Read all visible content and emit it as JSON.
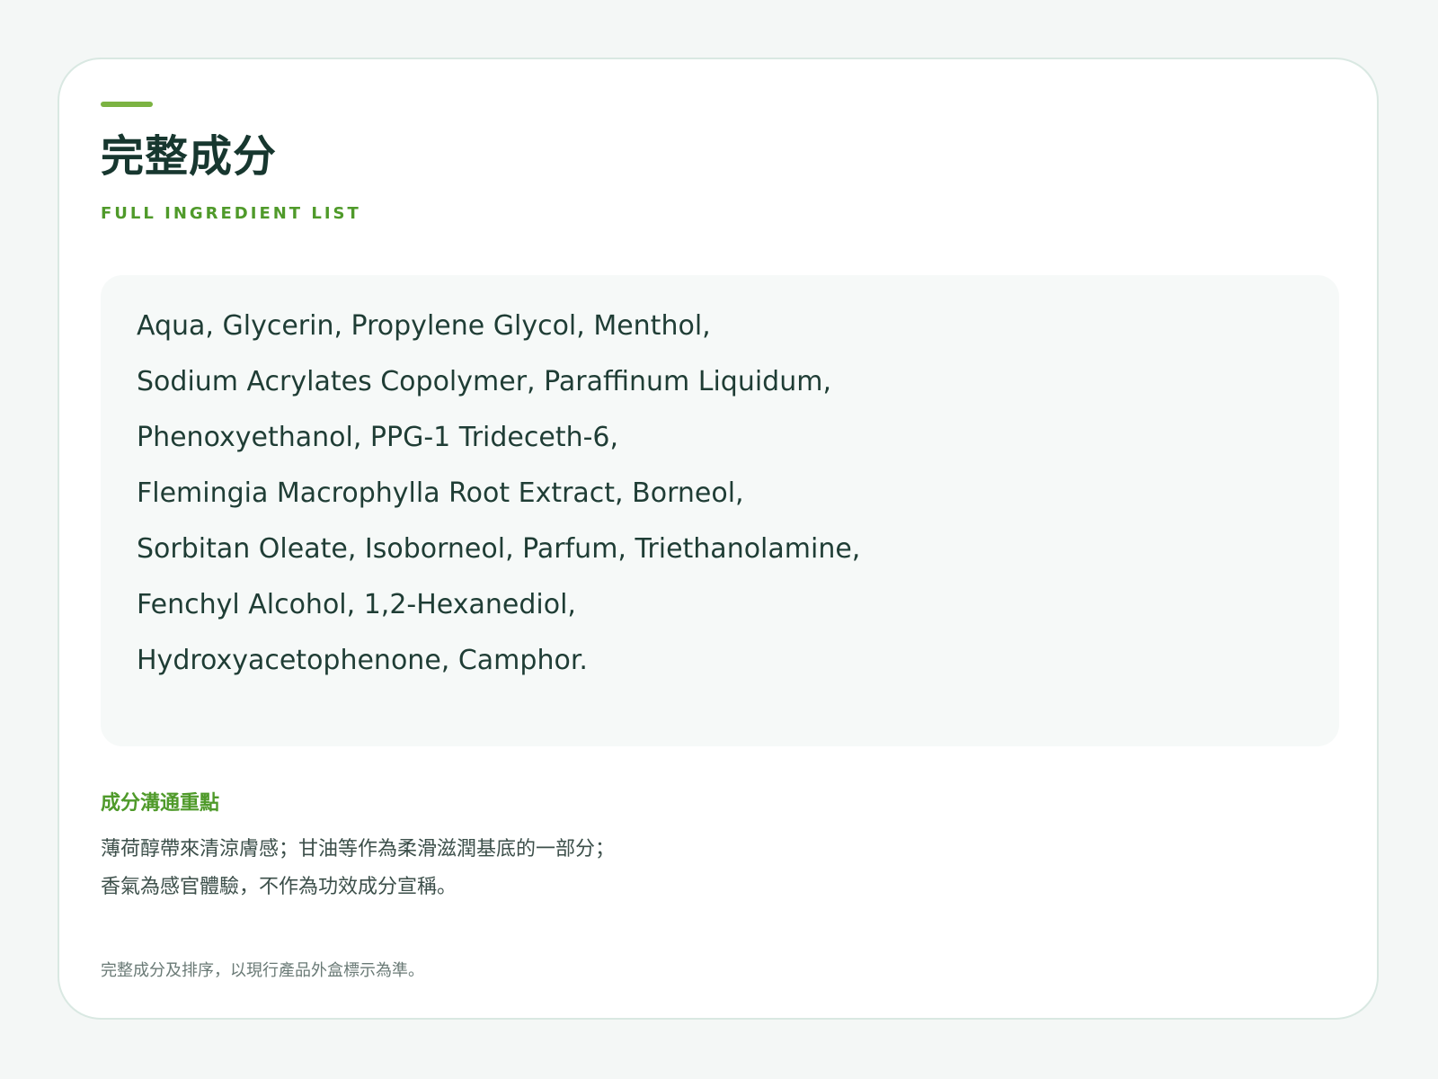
{
  "header": {
    "title": "完整成分",
    "subtitle": "FULL INGREDIENT LIST"
  },
  "ingredients": {
    "lines": [
      "Aqua, Glycerin, Propylene Glycol, Menthol,",
      "Sodium Acrylates Copolymer, Paraffinum Liquidum,",
      "Phenoxyethanol, PPG-1 Trideceth-6,",
      "Flemingia Macrophylla Root Extract, Borneol,",
      "Sorbitan Oleate, Isoborneol, Parfum, Triethanolamine,",
      "Fenchyl Alcohol, 1,2-Hexanediol,",
      "Hydroxyacetophenone, Camphor."
    ]
  },
  "highlights": {
    "title": "成分溝通重點",
    "lines": [
      "薄荷醇帶來清涼膚感；甘油等作為柔滑滋潤基底的一部分；",
      "香氣為感官體驗，不作為功效成分宣稱。"
    ]
  },
  "footnote": "完整成分及排序，以現行產品外盒標示為準。",
  "colors": {
    "background": "#f4f7f6",
    "card": "#ffffff",
    "accent": "#7cb342",
    "title": "#17372f",
    "subtitle": "#4f9a2a",
    "ingredient_box": "#f6f9f8"
  }
}
